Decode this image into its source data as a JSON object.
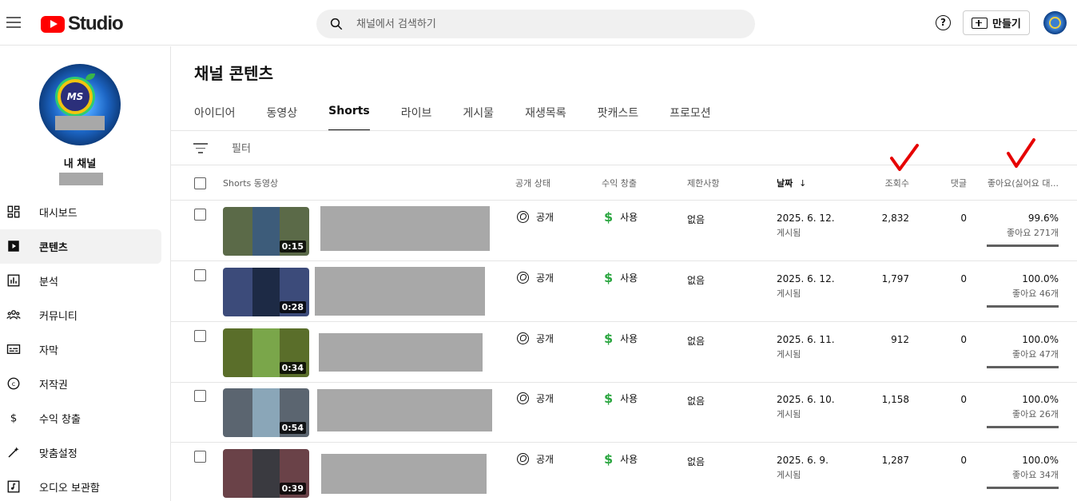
{
  "topbar": {
    "logo_text": "Studio",
    "search_placeholder": "채널에서 검색하기",
    "help_label": "?",
    "create_label": "만들기"
  },
  "sidebar": {
    "channel_title": "내 채널",
    "avatar_text": "MS",
    "items": [
      {
        "label": "대시보드",
        "icon": "dashboard-icon"
      },
      {
        "label": "콘텐츠",
        "icon": "content-icon",
        "active": true
      },
      {
        "label": "분석",
        "icon": "analytics-icon"
      },
      {
        "label": "커뮤니티",
        "icon": "community-icon"
      },
      {
        "label": "자막",
        "icon": "subtitles-icon"
      },
      {
        "label": "저작권",
        "icon": "copyright-icon"
      },
      {
        "label": "수익 창출",
        "icon": "monetization-icon"
      },
      {
        "label": "맞춤설정",
        "icon": "customization-icon"
      },
      {
        "label": "오디오 보관함",
        "icon": "audio-library-icon"
      }
    ]
  },
  "main": {
    "title": "채널 콘텐츠",
    "tabs": [
      {
        "label": "아이디어"
      },
      {
        "label": "동영상"
      },
      {
        "label": "Shorts",
        "active": true
      },
      {
        "label": "라이브"
      },
      {
        "label": "게시물"
      },
      {
        "label": "재생목록"
      },
      {
        "label": "팟캐스트"
      },
      {
        "label": "프로모션"
      }
    ],
    "filter_label": "필터",
    "columns": {
      "video": "Shorts 동영상",
      "visibility": "공개 상태",
      "monetization": "수익 창출",
      "restrictions": "제한사항",
      "date": "날짜",
      "date_sort": "↓",
      "views": "조회수",
      "comments": "댓글",
      "likes": "좋아요(싫어요 대..."
    },
    "rows": [
      {
        "duration": "0:15",
        "visibility": "공개",
        "monetization": "사용",
        "restrictions": "없음",
        "date": "2025. 6. 12.",
        "date_status": "게시됨",
        "views": "2,832",
        "comments": "0",
        "likes_pct": "99.6%",
        "likes_count": "좋아요 271개",
        "like_ratio": 0.996,
        "thumb_color": "#5b6a48",
        "thumb_center": "#3d5c7a"
      },
      {
        "duration": "0:28",
        "visibility": "공개",
        "monetization": "사용",
        "restrictions": "없음",
        "date": "2025. 6. 12.",
        "date_status": "게시됨",
        "views": "1,797",
        "comments": "0",
        "likes_pct": "100.0%",
        "likes_count": "좋아요 46개",
        "like_ratio": 1.0,
        "thumb_color": "#3c4b7a",
        "thumb_center": "#1d2a45"
      },
      {
        "duration": "0:34",
        "visibility": "공개",
        "monetization": "사용",
        "restrictions": "없음",
        "date": "2025. 6. 11.",
        "date_status": "게시됨",
        "views": "912",
        "comments": "0",
        "likes_pct": "100.0%",
        "likes_count": "좋아요 47개",
        "like_ratio": 1.0,
        "thumb_color": "#5a6e2a",
        "thumb_center": "#7aa64a"
      },
      {
        "duration": "0:54",
        "visibility": "공개",
        "monetization": "사용",
        "restrictions": "없음",
        "date": "2025. 6. 10.",
        "date_status": "게시됨",
        "views": "1,158",
        "comments": "0",
        "likes_pct": "100.0%",
        "likes_count": "좋아요 26개",
        "like_ratio": 1.0,
        "thumb_color": "#5b6570",
        "thumb_center": "#8aa6b8"
      },
      {
        "duration": "0:39",
        "visibility": "공개",
        "monetization": "사용",
        "restrictions": "없음",
        "date": "2025. 6. 9.",
        "date_status": "게시됨",
        "views": "1,287",
        "comments": "0",
        "likes_pct": "100.0%",
        "likes_count": "좋아요 34개",
        "like_ratio": 1.0,
        "thumb_color": "#6a4248",
        "thumb_center": "#3a3a40"
      }
    ]
  },
  "colors": {
    "accent_red": "#ff0000",
    "money_green": "#2ba640",
    "annotation_red": "#e60000"
  }
}
